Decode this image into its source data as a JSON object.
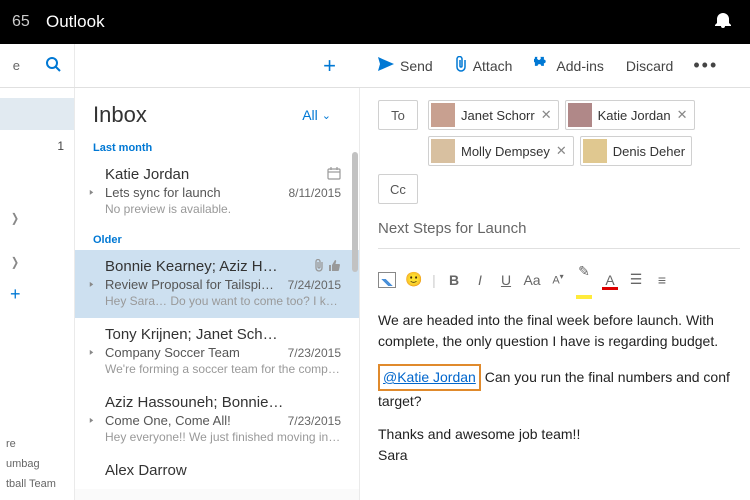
{
  "topbar": {
    "suite_partial": "65",
    "app_title": "Outlook"
  },
  "cmdbar": {
    "left_letter": "e",
    "send": "Send",
    "attach": "Attach",
    "addins": "Add-ins",
    "discard": "Discard"
  },
  "nav": {
    "row_count": "1",
    "labels": [
      "re",
      "umbag",
      "tball Team"
    ]
  },
  "msglist": {
    "folder": "Inbox",
    "filter": "All",
    "groups": [
      {
        "header": "Last month",
        "items": [
          {
            "sender": "Katie Jordan",
            "subject": "Lets sync for launch",
            "date": "8/11/2015",
            "preview": "No preview is available.",
            "right_icon": "calendar",
            "sel": false
          }
        ]
      },
      {
        "header": "Older",
        "items": [
          {
            "sender": "Bonnie Kearney; Aziz H…",
            "subject": "Review Proposal for Tailspin Toys",
            "date": "7/24/2015",
            "preview": "Hey Sara… Do you want to come too? I know…",
            "right_icon": "attach-like",
            "sel": true
          },
          {
            "sender": "Tony Krijnen; Janet Sch…",
            "subject": "Company Soccer Team",
            "date": "7/23/2015",
            "preview": "We're forming a soccer team for the compan…",
            "sel": false
          },
          {
            "sender": "Aziz Hassouneh; Bonnie…",
            "subject": "Come One, Come All!",
            "date": "7/23/2015",
            "preview": "Hey everyone!! We just finished moving into …",
            "sel": false
          },
          {
            "sender": "Alex Darrow",
            "subject": "",
            "date": "",
            "preview": "",
            "sel": false
          }
        ]
      }
    ]
  },
  "compose": {
    "to_label": "To",
    "cc_label": "Cc",
    "recipients": [
      {
        "name": "Janet Schorr",
        "avatar": "a1"
      },
      {
        "name": "Katie Jordan",
        "avatar": "a2"
      },
      {
        "name": "Molly Dempsey",
        "avatar": "a3"
      },
      {
        "name": "Denis Deher",
        "avatar": "a4"
      }
    ],
    "subject": "Next Steps for Launch",
    "body": {
      "p1": "We are headed into the final week before launch.  With",
      "p2": "complete, the only question I have is regarding budget.",
      "mention": "@Katie Jordan",
      "p3_after": "  Can you run the final numbers and conf",
      "p3_line2": "target?",
      "p4": "Thanks and awesome job team!!",
      "p5": "Sara"
    }
  }
}
